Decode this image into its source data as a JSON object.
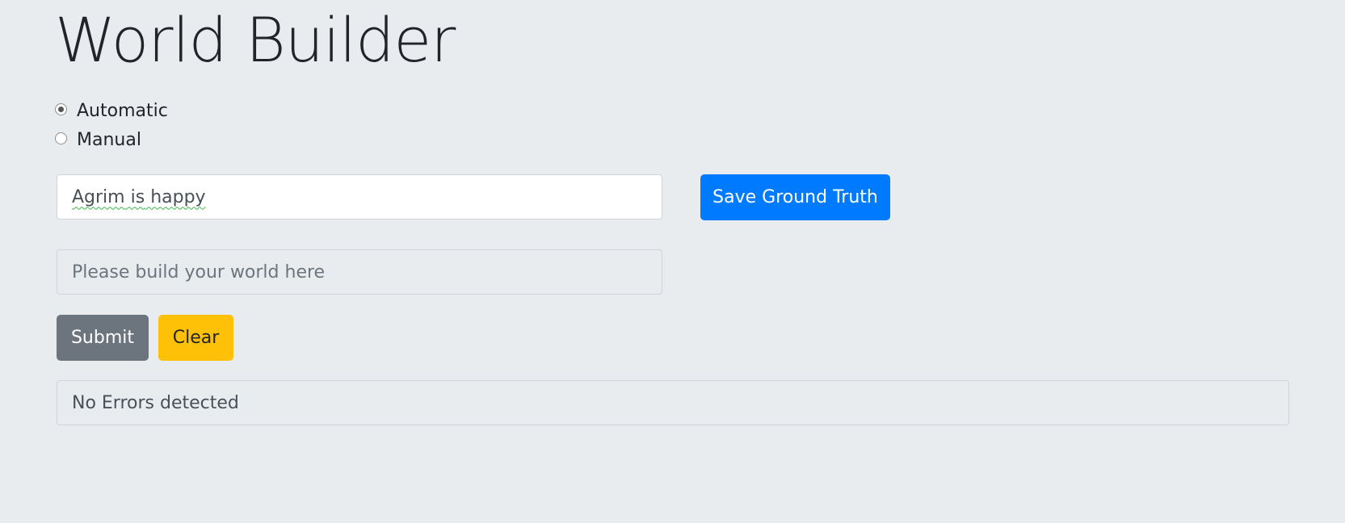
{
  "page": {
    "title": "World Builder"
  },
  "mode": {
    "options": [
      {
        "label": "Automatic",
        "checked": true
      },
      {
        "label": "Manual",
        "checked": false
      }
    ]
  },
  "ground_truth": {
    "value_word1": "Agrim",
    "value_word2": "is",
    "value_word3": "happy",
    "save_label": "Save Ground Truth"
  },
  "world_input": {
    "placeholder": "Please build your world here"
  },
  "actions": {
    "submit_label": "Submit",
    "clear_label": "Clear"
  },
  "status": {
    "message": "No Errors detected"
  },
  "colors": {
    "background": "#e9ecef",
    "primary": "#007bff",
    "secondary": "#6c757d",
    "warning": "#ffc107"
  }
}
